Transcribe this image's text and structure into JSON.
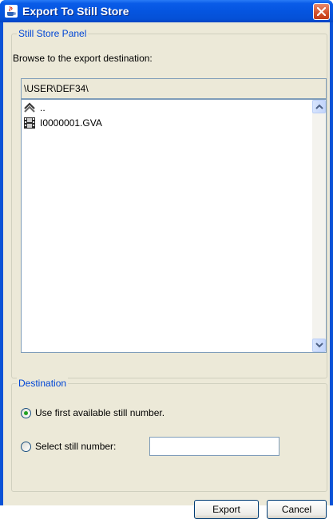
{
  "window": {
    "title": "Export To Still Store"
  },
  "store_panel": {
    "legend": "Still Store Panel",
    "browse_label": "Browse to the export destination:",
    "path": "\\USER\\DEF34\\",
    "items": [
      {
        "icon": "up-folder-icon",
        "label": ".."
      },
      {
        "icon": "film-icon",
        "label": "I0000001.GVA"
      }
    ]
  },
  "destination": {
    "legend": "Destination",
    "option_first": "Use first available still number.",
    "option_select": "Select still number:",
    "selected": "first",
    "still_number": ""
  },
  "buttons": {
    "export": "Export",
    "cancel": "Cancel"
  },
  "colors": {
    "titlebar": "#0555e0",
    "legend": "#0046d5",
    "dialog_bg": "#ece9d8"
  }
}
